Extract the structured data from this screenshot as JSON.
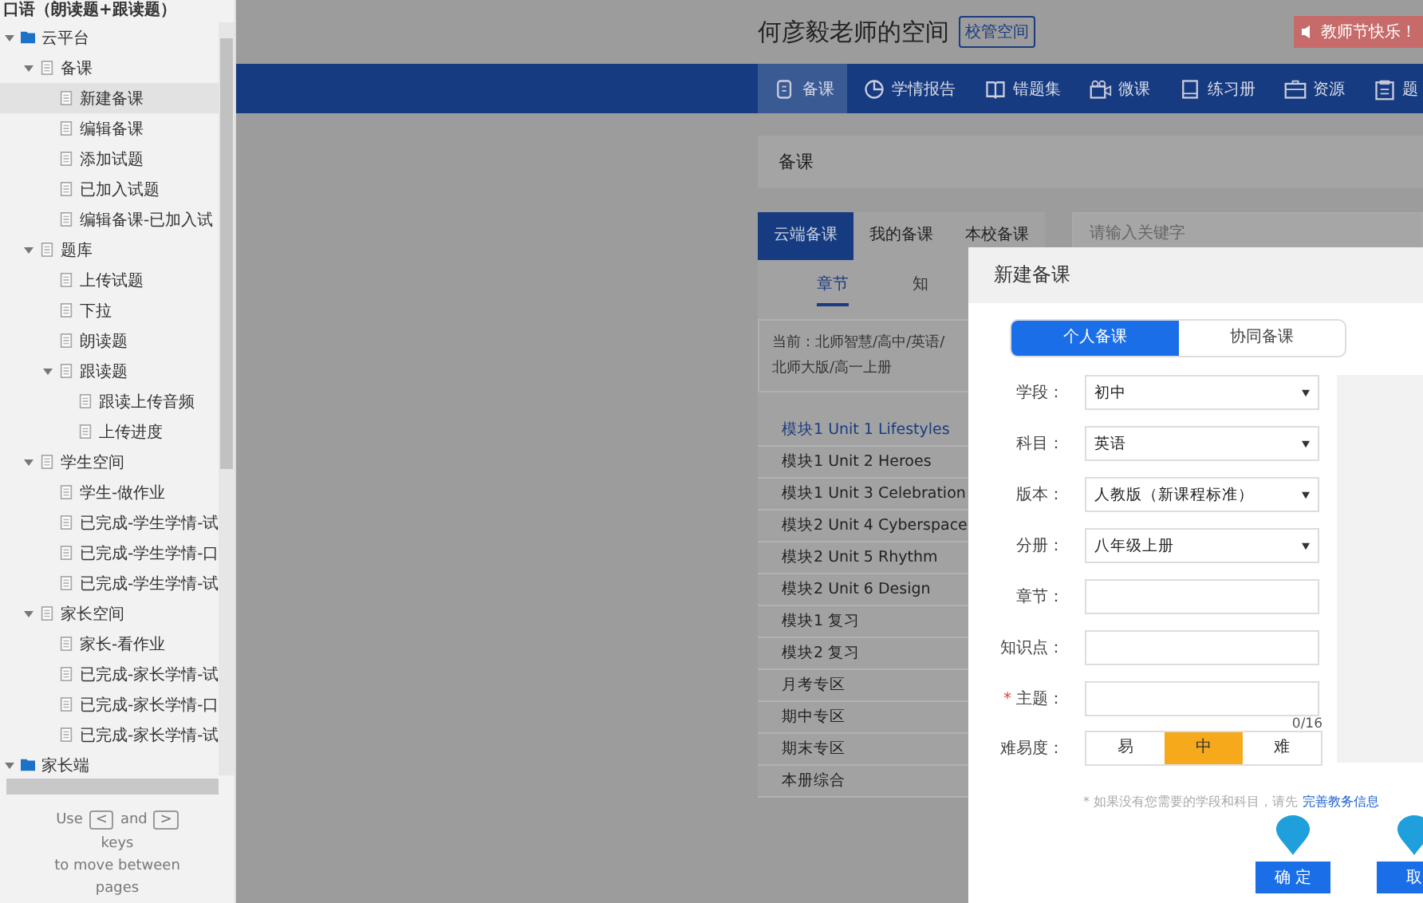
{
  "sidebar": {
    "title": "口语（朗读题+跟读题）",
    "tree": [
      {
        "label": "云平台",
        "kind": "folder",
        "expanded": true,
        "selected": false,
        "children": [
          {
            "label": "备课",
            "kind": "page",
            "expanded": true,
            "selected": false,
            "children": [
              {
                "label": "新建备课",
                "kind": "page",
                "selected": true
              },
              {
                "label": "编辑备课",
                "kind": "page",
                "selected": false
              },
              {
                "label": "添加试题",
                "kind": "page",
                "selected": false
              },
              {
                "label": "已加入试题",
                "kind": "page",
                "selected": false
              },
              {
                "label": "编辑备课-已加入试",
                "kind": "page",
                "selected": false
              }
            ]
          },
          {
            "label": "题库",
            "kind": "page",
            "expanded": true,
            "selected": false,
            "children": [
              {
                "label": "上传试题",
                "kind": "page",
                "selected": false
              },
              {
                "label": "下拉",
                "kind": "page",
                "selected": false
              },
              {
                "label": "朗读题",
                "kind": "page",
                "selected": false
              },
              {
                "label": "跟读题",
                "kind": "page",
                "expanded": true,
                "selected": false,
                "children": [
                  {
                    "label": "跟读上传音频",
                    "kind": "page",
                    "selected": false
                  },
                  {
                    "label": "上传进度",
                    "kind": "page",
                    "selected": false
                  }
                ]
              }
            ]
          },
          {
            "label": "学生空间",
            "kind": "page",
            "expanded": true,
            "selected": false,
            "children": [
              {
                "label": "学生-做作业",
                "kind": "page",
                "selected": false
              },
              {
                "label": "已完成-学生学情-试",
                "kind": "page",
                "selected": false
              },
              {
                "label": "已完成-学生学情-口",
                "kind": "page",
                "selected": false
              },
              {
                "label": "已完成-学生学情-试",
                "kind": "page",
                "selected": false
              }
            ]
          },
          {
            "label": "家长空间",
            "kind": "page",
            "expanded": true,
            "selected": false,
            "children": [
              {
                "label": "家长-看作业",
                "kind": "page",
                "selected": false
              },
              {
                "label": "已完成-家长学情-试",
                "kind": "page",
                "selected": false
              },
              {
                "label": "已完成-家长学情-口",
                "kind": "page",
                "selected": false
              },
              {
                "label": "已完成-家长学情-试",
                "kind": "page",
                "selected": false
              }
            ]
          }
        ]
      },
      {
        "label": "家长端",
        "kind": "folder",
        "expanded": true,
        "selected": false
      }
    ],
    "hint": {
      "before": "Use",
      "key_1": "<",
      "middle": "and",
      "key_2": ">",
      "line_2": "keys",
      "line_3": "to move between",
      "line_4": "pages"
    }
  },
  "header": {
    "title": "何彦毅老师的空间",
    "badge": "校管空间",
    "notice": "教师节快乐！"
  },
  "nav": [
    {
      "label": "备课",
      "selected": true
    },
    {
      "label": "学情报告",
      "selected": false
    },
    {
      "label": "错题集",
      "selected": false
    },
    {
      "label": "微课",
      "selected": false
    },
    {
      "label": "练习册",
      "selected": false
    },
    {
      "label": "资源",
      "selected": false
    },
    {
      "label": "题",
      "selected": false
    }
  ],
  "page_title": "备课",
  "tabs": [
    {
      "label": "云端备课",
      "selected": true
    },
    {
      "label": "我的备课",
      "selected": false
    },
    {
      "label": "本校备课",
      "selected": false
    }
  ],
  "subtabs": [
    {
      "label": "章节",
      "selected": true
    },
    {
      "label": "知",
      "selected": false
    }
  ],
  "path": [
    "当前：北师智慧/高中/英语/",
    "北师大版/高一上册"
  ],
  "chapters": [
    {
      "label": "模块1 Unit 1 Lifestyles",
      "selected": true
    },
    {
      "label": "模块1 Unit 2 Heroes",
      "selected": false
    },
    {
      "label": "模块1 Unit 3 Celebration",
      "selected": false
    },
    {
      "label": "模块2 Unit 4 Cyberspace",
      "selected": false
    },
    {
      "label": "模块2 Unit 5 Rhythm",
      "selected": false
    },
    {
      "label": "模块2 Unit 6 Design",
      "selected": false
    },
    {
      "label": "模块1 复习",
      "selected": false
    },
    {
      "label": "模块2 复习",
      "selected": false
    },
    {
      "label": "月考专区",
      "selected": false
    },
    {
      "label": "期中专区",
      "selected": false
    },
    {
      "label": "期末专区",
      "selected": false
    },
    {
      "label": "本册综合",
      "selected": false
    }
  ],
  "search": {
    "placeholder": "请输入关键字"
  },
  "dialog": {
    "title": "新建备课",
    "modes": [
      {
        "label": "个人备课",
        "selected": true
      },
      {
        "label": "协同备课",
        "selected": false
      }
    ],
    "fields": [
      {
        "label": "学段：",
        "kind": "select",
        "value": "初中"
      },
      {
        "label": "科目：",
        "kind": "select",
        "value": "英语"
      },
      {
        "label": "版本：",
        "kind": "select",
        "value": "人教版（新课程标准）"
      },
      {
        "label": "分册：",
        "kind": "select",
        "value": "八年级上册"
      },
      {
        "label": "章节：",
        "kind": "input"
      },
      {
        "label": "知识点：",
        "kind": "input"
      },
      {
        "label": "主题：",
        "kind": "input",
        "required_mark": "*",
        "counter": "0/16"
      }
    ],
    "difficulty": {
      "label": "难易度：",
      "options": [
        {
          "label": "易",
          "selected": false
        },
        {
          "label": "中",
          "selected": true
        },
        {
          "label": "难",
          "selected": false
        }
      ]
    },
    "note": {
      "text": "* 如果没有您需要的学段和科目，请先",
      "link": "完善教务信息"
    },
    "buttons": [
      "确 定",
      "取"
    ]
  }
}
